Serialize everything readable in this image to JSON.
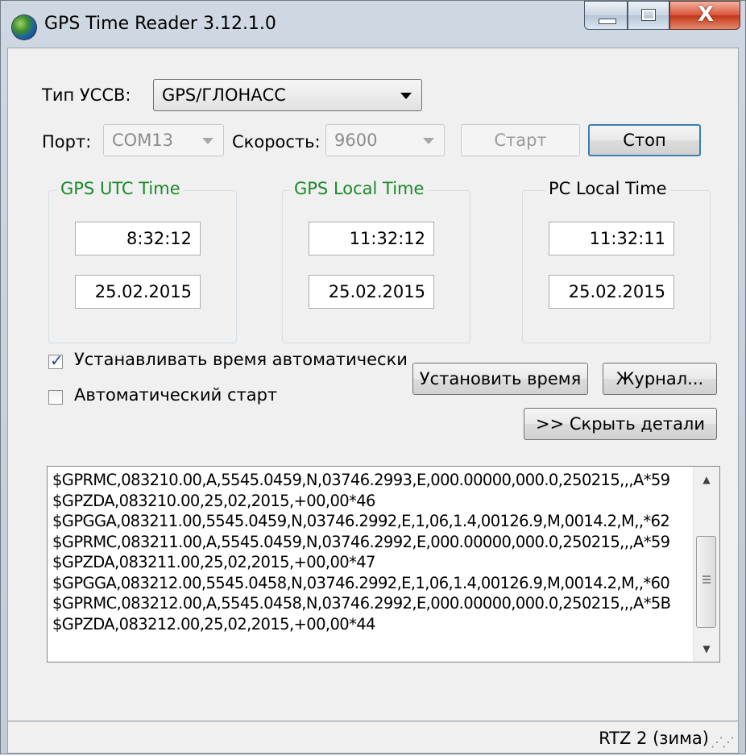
{
  "window": {
    "title": "GPS Time Reader 3.12.1.0",
    "close_glyph": "X"
  },
  "device": {
    "type_label": "Тип УССВ:",
    "type_value": "GPS/ГЛОНАСС",
    "port_label": "Порт:",
    "port_value": "COM13",
    "speed_label": "Скорость:",
    "speed_value": "9600",
    "start_label": "Старт",
    "stop_label": "Стоп"
  },
  "time_groups": [
    {
      "title": "GPS UTC Time",
      "time": "8:32:12",
      "date": "25.02.2015",
      "title_color": "#1a8a2a"
    },
    {
      "title": "GPS Local Time",
      "time": "11:32:12",
      "date": "25.02.2015",
      "title_color": "#1a8a2a"
    },
    {
      "title": "PC Local Time",
      "time": "11:32:11",
      "date": "25.02.2015",
      "title_color": "#000000"
    }
  ],
  "options": {
    "auto_time_label": "Устанавливать время автоматически",
    "auto_time_checked": true,
    "auto_start_label": "Автоматический старт",
    "auto_start_checked": false,
    "set_time_label": "Установить время",
    "journal_label": "Журнал...",
    "hide_details_label": ">> Скрыть детали"
  },
  "log": [
    "$GPRMC,083210.00,A,5545.0459,N,03746.2993,E,000.00000,000.0,250215,,,A*59",
    "$GPZDA,083210.00,25,02,2015,+00,00*46",
    "$GPGGA,083211.00,5545.0459,N,03746.2992,E,1,06,1.4,00126.9,M,0014.2,M,,*62",
    "$GPRMC,083211.00,A,5545.0459,N,03746.2992,E,000.00000,000.0,250215,,,A*59",
    "$GPZDA,083211.00,25,02,2015,+00,00*47",
    "$GPGGA,083212.00,5545.0458,N,03746.2992,E,1,06,1.4,00126.9,M,0014.2,M,,*60",
    "$GPRMC,083212.00,A,5545.0458,N,03746.2992,E,000.00000,000.0,250215,,,A*5B",
    "$GPZDA,083212.00,25,02,2015,+00,00*44"
  ],
  "status": {
    "timezone": "RTZ 2 (зима)"
  }
}
